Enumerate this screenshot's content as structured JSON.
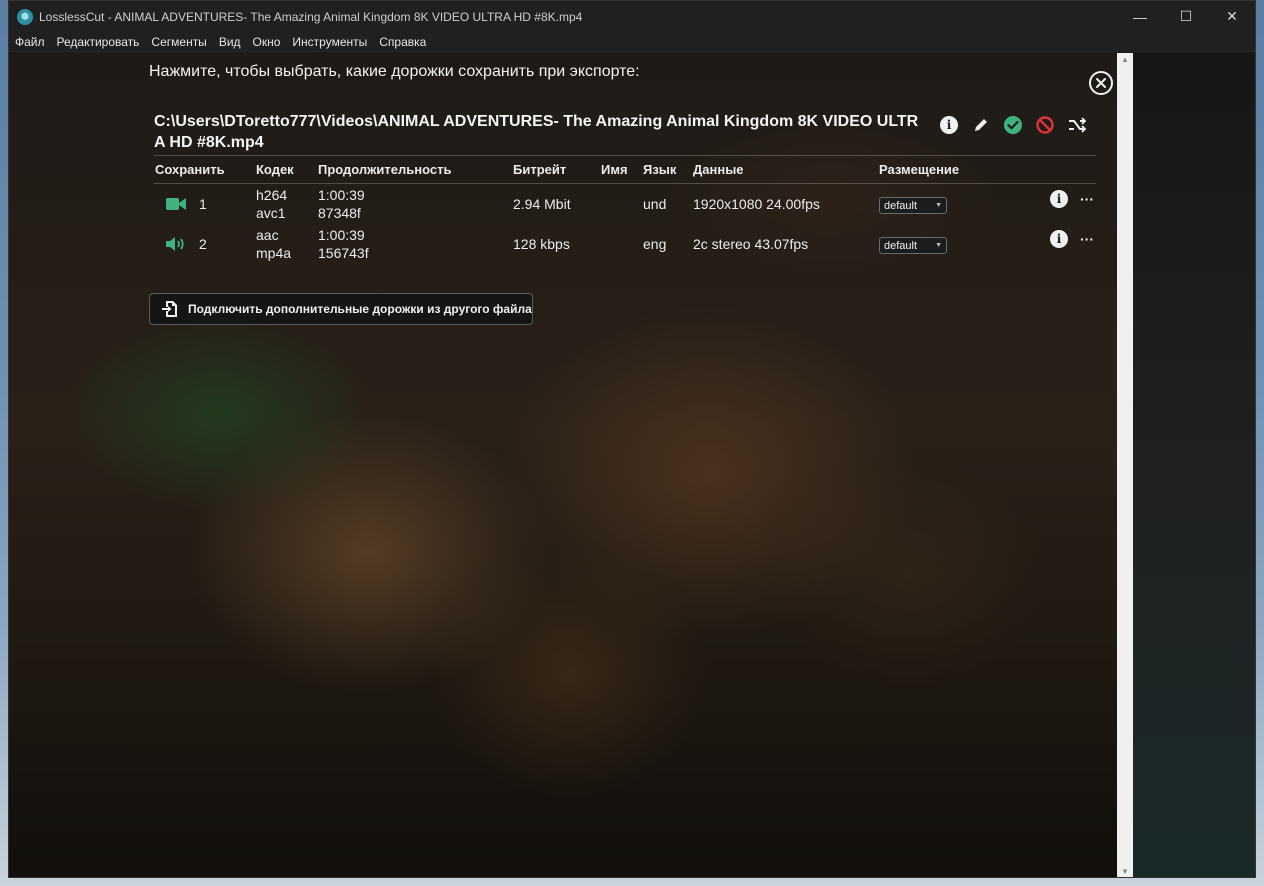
{
  "window": {
    "title": "LosslessCut - ANIMAL ADVENTURES- The Amazing Animal Kingdom 8K VIDEO ULTRA HD #8K.mp4",
    "controls": {
      "minimize": "—",
      "maximize": "☐",
      "close": "✕"
    }
  },
  "menu": [
    "Файл",
    "Редактировать",
    "Сегменты",
    "Вид",
    "Окно",
    "Инструменты",
    "Справка"
  ],
  "dialog": {
    "header": "Нажмите, чтобы выбрать, какие дорожки сохранить при экспорте:",
    "file_path": "C:\\Users\\DToretto777\\Videos\\ANIMAL ADVENTURES- The Amazing Animal Kingdom 8K VIDEO ULTRA HD #8K.mp4",
    "columns": {
      "save": "Сохранить",
      "codec": "Кодек",
      "duration": "Продолжительность",
      "bitrate": "Битрейт",
      "name": "Имя",
      "language": "Язык",
      "data": "Данные",
      "disposition": "Размещение"
    },
    "tracks": [
      {
        "icon": "video-camera-icon",
        "number": "1",
        "codec": "h264",
        "codec_tag": "avc1",
        "duration": "1:00:39",
        "frames": "87348f",
        "bitrate": "2.94 Mbit",
        "name": "",
        "language": "und",
        "data": "1920x1080 24.00fps",
        "disposition": "default"
      },
      {
        "icon": "speaker-icon",
        "number": "2",
        "codec": "aac",
        "codec_tag": "mp4a",
        "duration": "1:00:39",
        "frames": "156743f",
        "bitrate": "128 kbps",
        "name": "",
        "language": "eng",
        "data": "2c stereo 43.07fps",
        "disposition": "default"
      }
    ],
    "attach_button": "Подключить дополнительные дорожки из другого файла",
    "colors": {
      "accent_green": "#3fb27f",
      "reject_red": "#e0353d"
    }
  }
}
